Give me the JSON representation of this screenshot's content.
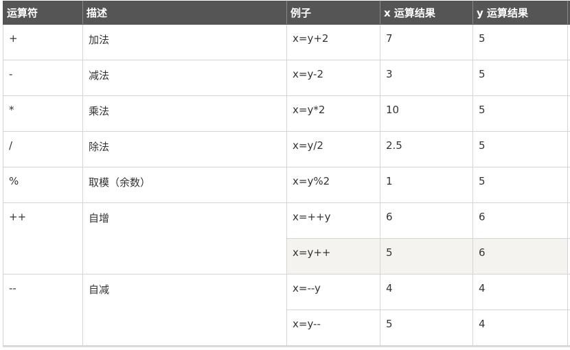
{
  "table": {
    "headers": [
      "运算符",
      "描述",
      "例子",
      "x 运算结果",
      "y 运算结果",
      ""
    ],
    "rows": [
      {
        "op": "+",
        "desc": "加法",
        "example": "x=y+2",
        "x": "7",
        "y": "5"
      },
      {
        "op": "-",
        "desc": "减法",
        "example": "x=y-2",
        "x": "3",
        "y": "5"
      },
      {
        "op": "*",
        "desc": "乘法",
        "example": "x=y*2",
        "x": "10",
        "y": "5"
      },
      {
        "op": "/",
        "desc": "除法",
        "example": "x=y/2",
        "x": "2.5",
        "y": "5"
      },
      {
        "op": "%",
        "desc": "取模（余数）",
        "example": "x=y%2",
        "x": "1",
        "y": "5"
      },
      {
        "op": "++",
        "desc": "自增",
        "example": "x=++y",
        "x": "6",
        "y": "6"
      },
      {
        "example": "x=y++",
        "x": "5",
        "y": "6"
      },
      {
        "op": "--",
        "desc": "自减",
        "example": "x=--y",
        "x": "4",
        "y": "4"
      },
      {
        "example": "x=y--",
        "x": "5",
        "y": "4"
      }
    ]
  }
}
